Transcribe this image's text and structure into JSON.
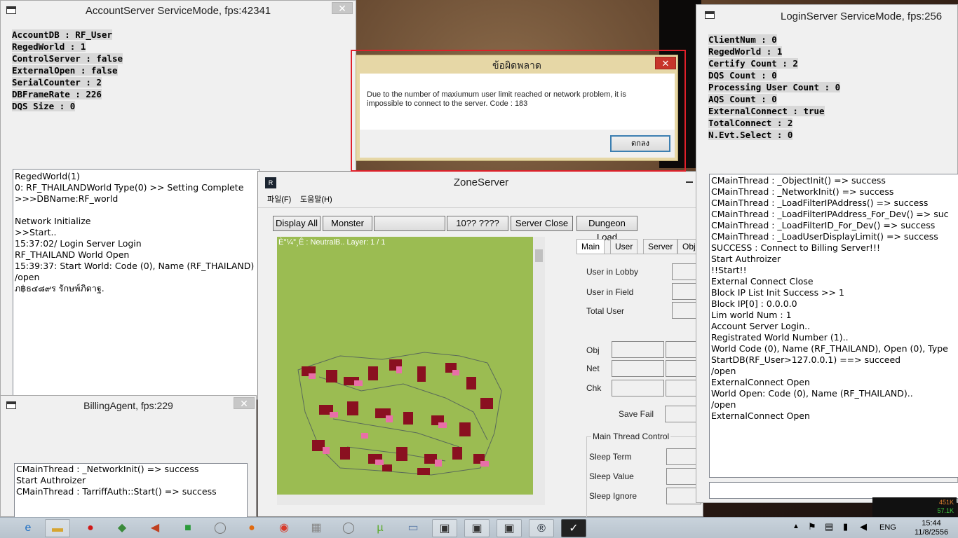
{
  "account_server": {
    "title": "AccountServer ServiceMode, fps:42341",
    "close_label": "✕",
    "stats": [
      "AccountDB : RF_User",
      "RegedWorld : 1",
      "ControlServer : false",
      "ExternalOpen : false",
      "SerialCounter : 2",
      "DBFrameRate : 226",
      "DQS Size : 0"
    ],
    "log": [
      "RegedWorld(1)",
      "0: RF_THAILANDWorld Type(0) >> Setting Complete",
      ">>>DBName:RF_world",
      "",
      "Network Initialize",
      ">>Start..",
      "15:37:02/ Login Server Login",
      "RF_THAILAND World Open",
      "15:39:37: Start World: Code (0), Name (RF_THAILAND)",
      "/open",
      "ภ฿ธ๔๘๙ร รักษพ์ภิดาฐ."
    ]
  },
  "billing_agent": {
    "title": "BillingAgent, fps:229",
    "close_label": "✕",
    "log": [
      "CMainThread : _NetworkInit() => success",
      "Start Authroizer",
      "CMainThread : TarriffAuth::Start() => success"
    ]
  },
  "login_server": {
    "title": "LoginServer ServiceMode, fps:256",
    "stats": [
      "ClientNum : 0",
      "RegedWorld : 1",
      "Certify Count : 2",
      "DQS Count : 0",
      "Processing User Count : 0",
      "AQS Count : 0",
      "ExternalConnect : true",
      "TotalConnect : 2",
      "N.Evt.Select : 0"
    ],
    "log": [
      "CMainThread : _ObjectInit() => success",
      "CMainThread : _NetworkInit() => success",
      "CMainThread : _LoadFilterIPAddress() => success",
      "CMainThread : _LoadFilterIPAddress_For_Dev() => suc",
      "CMainThread : _LoadFilterID_For_Dev() => success",
      "CMainThread : _LoadUserDisplayLimit() => success",
      "SUCCESS : Connect to Billing Server!!!",
      "Start Authroizer",
      "!!Start!!",
      "External Connect Close",
      "Block IP List Init Success >> 1",
      "Block IP[0] : 0.0.0.0",
      "Lim world Num : 1",
      "Account Server Login..",
      "Registrated World Number (1)..",
      "World Code (0), Name (RF_THAILAND), Open (0), Type",
      "StartDB(RF_User>127.0.0.1) ==> succeed",
      "/open",
      "ExternalConnect Open",
      "World Open: Code (0), Name (RF_THAILAND)..",
      "/open",
      "ExternalConnect Open"
    ]
  },
  "error_dialog": {
    "title": "ข้อผิดพลาด",
    "close_label": "✕",
    "message": "Due to the number of maxiumum user limit reached or network problem, it is impossible to connect to the server. Code : 183",
    "ok_label": "ตกลง"
  },
  "zone_server": {
    "title": "ZoneServer",
    "menu": [
      "파일(F)",
      "도움말(H)"
    ],
    "buttons": [
      "Display All",
      "Monster",
      "",
      "10?? ????",
      "Server Close",
      "Dungeon Load"
    ],
    "map_caption": "È°¼°¸Ê : NeutralB.. Layer: 1 / 1",
    "tabs": [
      "Main",
      "User",
      "Server",
      "Obj"
    ],
    "labels": {
      "user_in_lobby": "User in Lobby",
      "user_in_field": "User in Field",
      "total_user": "Total User",
      "obj": "Obj",
      "net": "Net",
      "chk": "Chk",
      "save_fail": "Save Fail",
      "main_thread_control": "Main Thread Control",
      "sleep_term": "Sleep Term",
      "sleep_value": "Sleep Value",
      "sleep_ignore": "Sleep Ignore"
    }
  },
  "taskbar": {
    "lang": "ENG",
    "time": "15:44",
    "date": "11/8/2556",
    "net_up": "451K",
    "net_down": "57.1K"
  },
  "colors": {
    "map_green": "#9bbc52",
    "error_border": "#e0202a",
    "dialog_title": "#e6d7a6",
    "close_red": "#c7352b"
  }
}
